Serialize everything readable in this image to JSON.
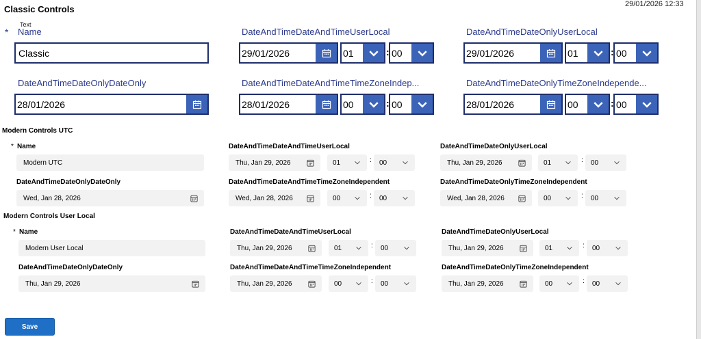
{
  "header": {
    "title": "Classic Controls",
    "timestamp": "29/01/2026 12:33",
    "tiny_text": "Text"
  },
  "classic": {
    "required_mark": "*",
    "name": {
      "label": "Name",
      "value": "Classic"
    },
    "dt_user_local": {
      "label": "DateAndTimeDateAndTimeUserLocal",
      "date": "29/01/2026",
      "hour": "01",
      "minute": "00"
    },
    "dateonly_user_local": {
      "label": "DateAndTimeDateOnlyUserLocal",
      "date": "29/01/2026",
      "hour": "01",
      "minute": "00"
    },
    "dateonly_dateonly": {
      "label": "DateAndTimeDateOnlyDateOnly",
      "date": "28/01/2026"
    },
    "dt_tz_indep": {
      "label": "DateAndTimeDateAndTimeTimeZoneIndep...",
      "date": "28/01/2026",
      "hour": "00",
      "minute": "00"
    },
    "dateonly_tz_indep": {
      "label": "DateAndTimeDateOnlyTimeZoneIndepende...",
      "date": "28/01/2026",
      "hour": "00",
      "minute": "00"
    },
    "colon": ":"
  },
  "modern_utc": {
    "heading": "Modern Controls UTC",
    "required_mark": "*",
    "name": {
      "label": "Name",
      "value": "Modern UTC"
    },
    "dt_user_local": {
      "label": "DateAndTimeDateAndTimeUserLocal",
      "date": "Thu, Jan 29, 2026",
      "hour": "01",
      "minute": "00"
    },
    "dateonly_user_local": {
      "label": "DateAndTimeDateOnlyUserLocal",
      "date": "Thu, Jan 29, 2026",
      "hour": "01",
      "minute": "00"
    },
    "dateonly_dateonly": {
      "label": "DateAndTimeDateOnlyDateOnly",
      "date": "Wed, Jan 28, 2026"
    },
    "dt_tz_indep": {
      "label": "DateAndTimeDateAndTimeTimeZoneIndependent",
      "date": "Wed, Jan 28, 2026",
      "hour": "00",
      "minute": "00"
    },
    "dateonly_tz_indep": {
      "label": "DateAndTimeDateOnlyTimeZoneIndependent",
      "date": "Wed, Jan 28, 2026",
      "hour": "00",
      "minute": "00"
    },
    "colon": ":"
  },
  "modern_local": {
    "heading": "Modern Controls User Local",
    "required_mark": "*",
    "name": {
      "label": "Name",
      "value": "Modern User Local"
    },
    "dt_user_local": {
      "label": "DateAndTimeDateAndTimeUserLocal",
      "date": "Thu, Jan 29, 2026",
      "hour": "01",
      "minute": "00"
    },
    "dateonly_user_local": {
      "label": "DateAndTimeDateOnlyUserLocal",
      "date": "Thu, Jan 29, 2026",
      "hour": "01",
      "minute": "00"
    },
    "dateonly_dateonly": {
      "label": "DateAndTimeDateOnlyDateOnly",
      "date": "Thu, Jan 29, 2026"
    },
    "dt_tz_indep": {
      "label": "DateAndTimeDateAndTimeTimeZoneIndependent",
      "date": "Thu, Jan 29, 2026",
      "hour": "00",
      "minute": "00"
    },
    "dateonly_tz_indep": {
      "label": "DateAndTimeDateOnlyTimeZoneIndependent",
      "date": "Thu, Jan 29, 2026",
      "hour": "00",
      "minute": "00"
    },
    "colon": ":"
  },
  "actions": {
    "save_label": "Save"
  },
  "colors": {
    "classic_border": "#1f2d6b",
    "classic_button": "#3b63b8",
    "classic_label": "#2b3a8c",
    "modern_field": "#f2f2f2",
    "save_button": "#1f6fc6"
  },
  "icons": {
    "calendar": "calendar-icon",
    "chevron": "chevron-down-icon"
  }
}
